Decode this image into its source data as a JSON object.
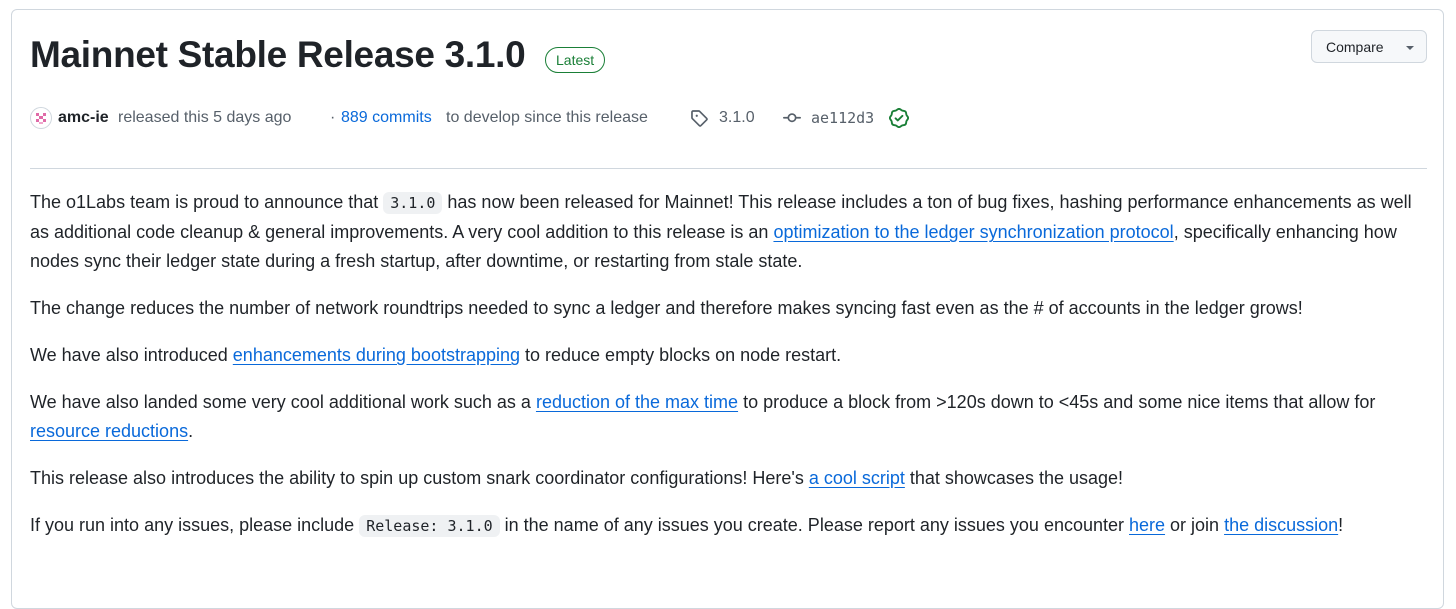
{
  "release": {
    "title": "Mainnet Stable Release 3.1.0",
    "badge": "Latest",
    "compare_label": "Compare"
  },
  "meta": {
    "author": "amc-ie",
    "released_text": "released this 5 days ago",
    "commits_prefix": "·",
    "commits_link": "889 commits",
    "commits_suffix": "to develop since this release",
    "tag": "3.1.0",
    "commit_hash": "ae112d3",
    "verified": true
  },
  "icons": {
    "avatar": "identicon-avatar",
    "tag": "tag-icon",
    "commit": "git-commit-icon",
    "verified": "check-circle-icon",
    "caret": "triangle-down-icon"
  },
  "colors": {
    "link": "#0969da",
    "latest_badge": "#1a7f37",
    "verified": "#1a7f37",
    "text": "#1f2328",
    "muted": "#57606a",
    "border": "#d0d7de"
  },
  "content": {
    "p1": {
      "a": "The o1Labs team is proud to announce that ",
      "code": "3.1.0",
      "b": " has now been released for Mainnet! This release includes a ton of bug fixes, hashing performance enhancements as well as additional code cleanup & general improvements. A very cool addition to this release is an ",
      "link": "optimization to the ledger synchronization protocol",
      "c": ", specifically enhancing how nodes sync their ledger state during a fresh startup, after downtime, or restarting from stale state."
    },
    "p2": "The change reduces the number of network roundtrips needed to sync a ledger and therefore makes syncing fast even as the # of accounts in the ledger grows!",
    "p3": {
      "a": "We have also introduced ",
      "link": "enhancements during bootstrapping",
      "b": " to reduce empty blocks on node restart."
    },
    "p4": {
      "a": "We have also landed some very cool additional work such as a ",
      "link1": "reduction of the max time",
      "b": " to produce a block from >120s down to <45s and some nice items that allow for ",
      "link2": "resource reductions",
      "c": "."
    },
    "p5": {
      "a": "This release also introduces the ability to spin up custom snark coordinator configurations! Here's ",
      "link": "a cool script",
      "b": " that showcases the usage!"
    },
    "p6": {
      "a": "If you run into any issues, please include ",
      "code": "Release: 3.1.0",
      "b": " in the name of any issues you create. Please report any issues you encounter ",
      "link1": "here",
      "c": " or join ",
      "link2": "the discussion",
      "d": "!"
    }
  }
}
